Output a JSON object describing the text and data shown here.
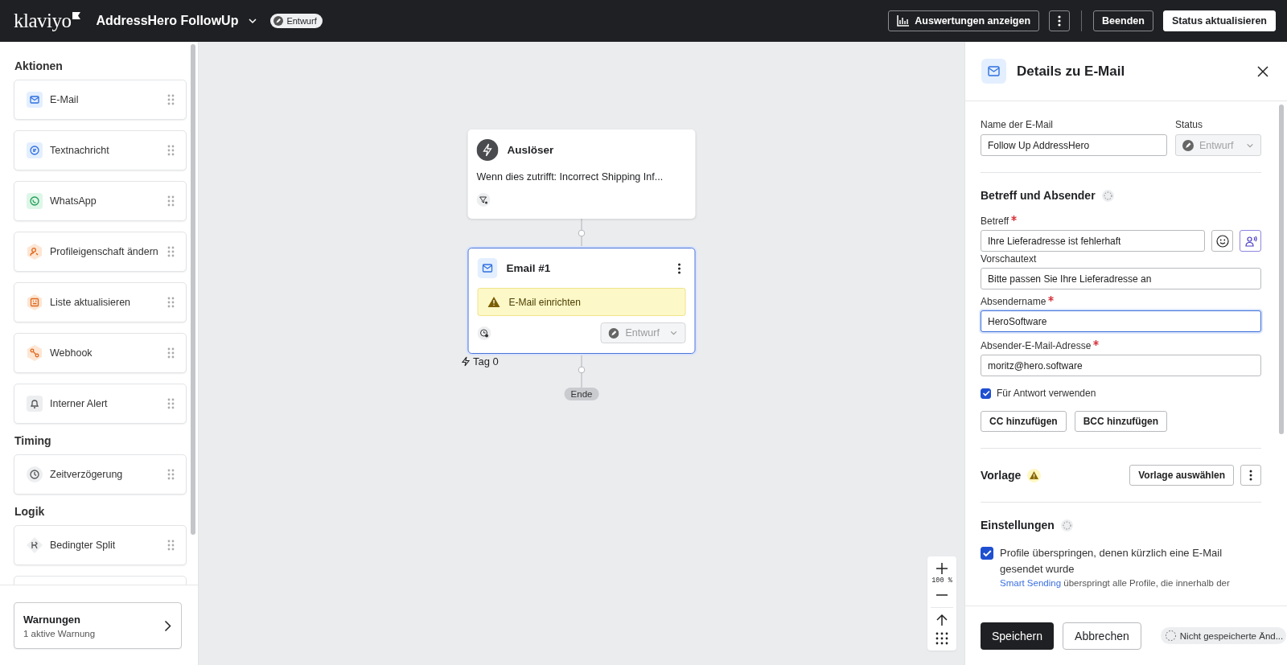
{
  "header": {
    "logo": "klaviyo",
    "flow_name": "AddressHero FollowUp",
    "status_badge": "Entwurf",
    "buttons": [
      {
        "kind": "analytics",
        "label": "Auswertungen anzeigen"
      },
      {
        "kind": "more"
      },
      {
        "kind": "divider"
      },
      {
        "kind": "secondary",
        "label": "Beenden"
      },
      {
        "kind": "primary",
        "label": "Status aktualisieren"
      }
    ]
  },
  "sidebar": {
    "sections": [
      {
        "title": "Aktionen",
        "items": [
          {
            "kind": "email",
            "label": "E-Mail"
          },
          {
            "kind": "sms",
            "label": "Textnachricht"
          },
          {
            "kind": "whatsapp",
            "label": "WhatsApp"
          },
          {
            "kind": "profile",
            "label": "Profileigenschaft ändern"
          },
          {
            "kind": "list",
            "label": "Liste aktualisieren"
          },
          {
            "kind": "webhook",
            "label": "Webhook"
          },
          {
            "kind": "alert",
            "label": "Interner Alert"
          }
        ]
      },
      {
        "title": "Timing",
        "items": [
          {
            "kind": "delay",
            "label": "Zeitverzögerung"
          }
        ]
      },
      {
        "title": "Logik",
        "items": [
          {
            "kind": "split",
            "label": "Bedingter Split"
          }
        ]
      }
    ],
    "warnings": {
      "title": "Warnungen",
      "subtitle": "1 aktive Warnung"
    }
  },
  "canvas": {
    "trigger": {
      "title": "Auslöser",
      "text": "Wenn dies zutrifft: Incorrect Shipping Inf..."
    },
    "email_node": {
      "title": "Email #1",
      "selected": true,
      "warning": "E-Mail einrichten",
      "status": "Entwurf",
      "day_label": "Tag 0"
    },
    "end_label": "Ende",
    "zoom": {
      "level_label": "100 %"
    }
  },
  "panel": {
    "title": "Details zu E-Mail",
    "name_label": "Name der E-Mail",
    "name_value": "Follow Up AddressHero",
    "status_label": "Status",
    "status_value": "Entwurf",
    "sender_section": "Betreff und Absender",
    "fields": [
      {
        "kind": "subject",
        "label": "Betreff",
        "required": true,
        "value": "Ihre Lieferadresse ist fehlerhaft",
        "focused": false
      },
      {
        "kind": "text",
        "label": "Vorschautext",
        "required": false,
        "value": "Bitte passen Sie Ihre Lieferadresse an",
        "focused": false
      },
      {
        "kind": "text",
        "label": "Absendername",
        "required": true,
        "value": "HeroSoftware",
        "focused": true
      },
      {
        "kind": "text",
        "label": "Absender-E-Mail-Adresse",
        "required": true,
        "value": "moritz@hero.software",
        "focused": false
      }
    ],
    "reply": {
      "label": "Für Antwort verwenden",
      "checked": true
    },
    "add_buttons": [
      "CC hinzufügen",
      "BCC hinzufügen"
    ],
    "template": {
      "title": "Vorlage",
      "warning": true,
      "button": "Vorlage auswählen"
    },
    "settings": {
      "title": "Einstellungen",
      "option": {
        "label": "Profile überspringen, denen kürzlich eine E-Mail gesendet wurde",
        "checked": true,
        "link": "Smart Sending",
        "description": "überspringt alle Profile, die innerhalb der"
      }
    },
    "footer": {
      "save": "Speichern",
      "cancel": "Abbrechen",
      "unsaved": "Nicht gespeicherte Änd..."
    }
  }
}
